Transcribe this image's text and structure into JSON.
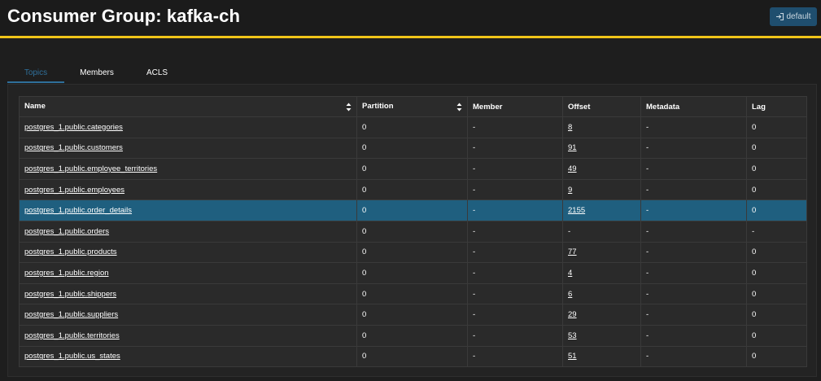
{
  "header": {
    "title": "Consumer Group: kafka-ch",
    "login_label": "default"
  },
  "tabs": [
    {
      "label": "Topics"
    },
    {
      "label": "Members"
    },
    {
      "label": "ACLS"
    }
  ],
  "table": {
    "columns": [
      "Name",
      "Partition",
      "Member",
      "Offset",
      "Metadata",
      "Lag"
    ],
    "rows": [
      {
        "name": "postgres_1.public.categories",
        "partition": "0",
        "member": "-",
        "offset": "8",
        "metadata": "-",
        "lag": "0"
      },
      {
        "name": "postgres_1.public.customers",
        "partition": "0",
        "member": "-",
        "offset": "91",
        "metadata": "-",
        "lag": "0"
      },
      {
        "name": "postgres_1.public.employee_territories",
        "partition": "0",
        "member": "-",
        "offset": "49",
        "metadata": "-",
        "lag": "0"
      },
      {
        "name": "postgres_1.public.employees",
        "partition": "0",
        "member": "-",
        "offset": "9",
        "metadata": "-",
        "lag": "0"
      },
      {
        "name": "postgres_1.public.order_details",
        "partition": "0",
        "member": "-",
        "offset": "2155",
        "metadata": "-",
        "lag": "0"
      },
      {
        "name": "postgres_1.public.orders",
        "partition": "0",
        "member": "-",
        "offset": "-",
        "metadata": "-",
        "lag": "-"
      },
      {
        "name": "postgres_1.public.products",
        "partition": "0",
        "member": "-",
        "offset": "77",
        "metadata": "-",
        "lag": "0"
      },
      {
        "name": "postgres_1.public.region",
        "partition": "0",
        "member": "-",
        "offset": "4",
        "metadata": "-",
        "lag": "0"
      },
      {
        "name": "postgres_1.public.shippers",
        "partition": "0",
        "member": "-",
        "offset": "6",
        "metadata": "-",
        "lag": "0"
      },
      {
        "name": "postgres_1.public.suppliers",
        "partition": "0",
        "member": "-",
        "offset": "29",
        "metadata": "-",
        "lag": "0"
      },
      {
        "name": "postgres_1.public.territories",
        "partition": "0",
        "member": "-",
        "offset": "53",
        "metadata": "-",
        "lag": "0"
      },
      {
        "name": "postgres_1.public.us_states",
        "partition": "0",
        "member": "-",
        "offset": "51",
        "metadata": "-",
        "lag": "0"
      }
    ]
  },
  "colors": {
    "accent_bar": "#f0c419",
    "active_tab": "#2f6f9a",
    "row_highlight": "#1f5f7f",
    "login_button_bg": "#1f4e6e"
  },
  "icons": {
    "login": "login-icon",
    "sort": "sort-icon"
  }
}
